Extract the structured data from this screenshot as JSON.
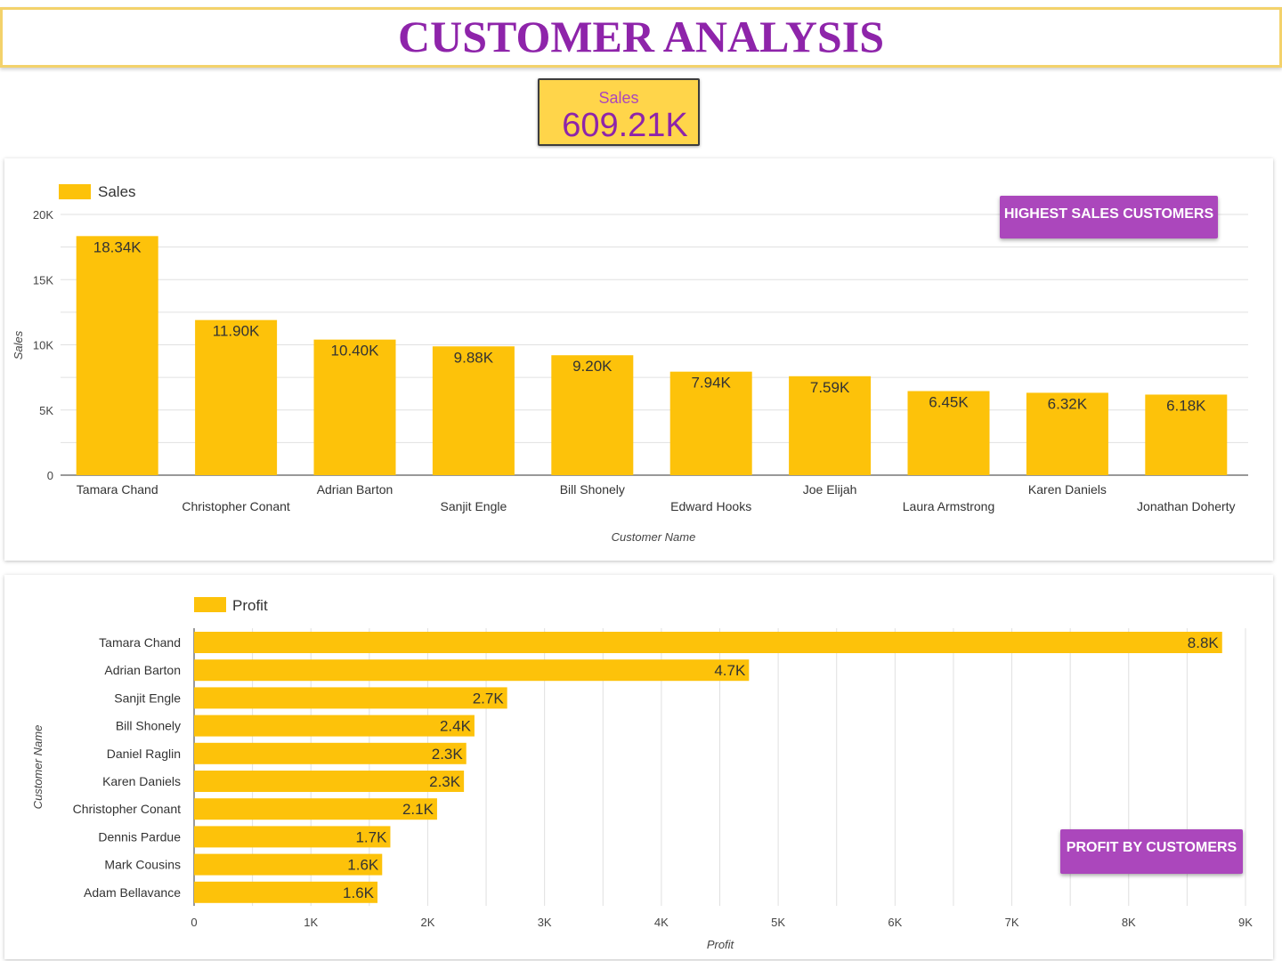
{
  "title": "CUSTOMER ANALYSIS",
  "kpi": {
    "label": "Sales",
    "value": "609.21K"
  },
  "sales_button": "HIGHEST SALES CUSTOMERS",
  "profit_button": "PROFIT BY CUSTOMERS",
  "colors": {
    "bar": "#fdc20a",
    "accent": "#ab47bc",
    "title": "#8e24aa",
    "kpi_bg": "#ffd54a"
  },
  "chart_data": [
    {
      "type": "bar",
      "orientation": "vertical",
      "legend": "Sales",
      "legend_position": "top-left",
      "xlabel": "Customer Name",
      "ylabel": "Sales",
      "ylim": [
        0,
        20000
      ],
      "yticks": [
        0,
        5000,
        10000,
        15000,
        20000
      ],
      "ytick_labels": [
        "0",
        "5K",
        "10K",
        "15K",
        "20K"
      ],
      "grid": true,
      "categories": [
        "Tamara Chand",
        "Christopher Conant",
        "Adrian Barton",
        "Sanjit Engle",
        "Bill Shonely",
        "Edward Hooks",
        "Joe Elijah",
        "Laura Armstrong",
        "Karen Daniels",
        "Jonathan Doherty"
      ],
      "values": [
        18340,
        11900,
        10400,
        9880,
        9200,
        7940,
        7590,
        6450,
        6320,
        6180
      ],
      "value_labels": [
        "18.34K",
        "11.90K",
        "10.40K",
        "9.88K",
        "9.20K",
        "7.94K",
        "7.59K",
        "6.45K",
        "6.32K",
        "6.18K"
      ]
    },
    {
      "type": "bar",
      "orientation": "horizontal",
      "legend": "Profit",
      "legend_position": "top-left",
      "xlabel": "Profit",
      "ylabel": "Customer Name",
      "xlim": [
        0,
        9000
      ],
      "xticks": [
        0,
        1000,
        2000,
        3000,
        4000,
        5000,
        6000,
        7000,
        8000,
        9000
      ],
      "xtick_labels": [
        "0",
        "1K",
        "2K",
        "3K",
        "4K",
        "5K",
        "6K",
        "7K",
        "8K",
        "9K"
      ],
      "grid": true,
      "categories": [
        "Tamara Chand",
        "Adrian Barton",
        "Sanjit Engle",
        "Bill Shonely",
        "Daniel Raglin",
        "Karen Daniels",
        "Christopher Conant",
        "Dennis Pardue",
        "Mark Cousins",
        "Adam Bellavance"
      ],
      "values": [
        8800,
        4750,
        2680,
        2400,
        2330,
        2310,
        2080,
        1680,
        1610,
        1570
      ],
      "value_labels": [
        "8.8K",
        "4.7K",
        "2.7K",
        "2.4K",
        "2.3K",
        "2.3K",
        "2.1K",
        "1.7K",
        "1.6K",
        "1.6K"
      ]
    }
  ]
}
